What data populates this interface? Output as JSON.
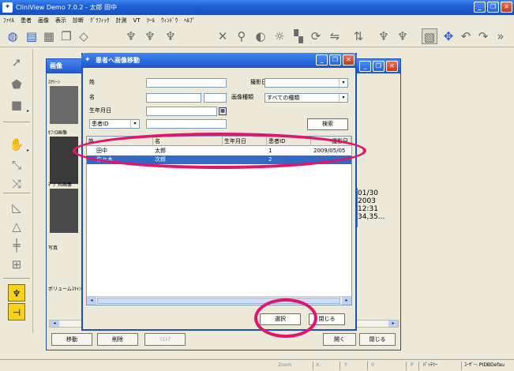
{
  "app": {
    "title": "CliniView Demo 7.0.2 - 太郎 田中",
    "menu": [
      "ﾌｧｲﾙ",
      "患者",
      "画像",
      "表示",
      "診断",
      "ｸﾞﾗﾌｨｯｸ",
      "計測",
      "VT",
      "ﾂｰﾙ",
      "ｳｨﾝﾄﾞｳ",
      "ﾍﾙﾌﾟ"
    ]
  },
  "patient_window": {
    "title": "画像",
    "thumb_labels": [
      "ｽｸﾘｰﾝ",
      "ｾﾌｧﾛ画像",
      "ﾃﾞｼﾞﾀﾙ画像",
      "写真",
      "ボリュームｽｷｬﾝ"
    ],
    "info": "01/30\n2003\n12:31\n34,35...",
    "buttons": {
      "move": "移動",
      "delete": "削除",
      "listing": "ﾘｽﾄｱ",
      "open": "開く",
      "close": "閉じる"
    }
  },
  "dialog": {
    "title": "患者へ画像移動",
    "labels": {
      "last_name": "姓",
      "first_name": "名",
      "birthdate": "生年月日",
      "capture_date": "撮影日",
      "image_type": "画像種類"
    },
    "image_type_value": "すべての種類",
    "id_type_value": "患者ID",
    "search_button": "検索",
    "columns": [
      "姓",
      "名",
      "生年月日",
      "患者ID",
      "撮影日"
    ],
    "rows": [
      {
        "last": "田中",
        "first": "太郎",
        "birth": "",
        "id": "1",
        "date": "2009/05/05"
      },
      {
        "last": "佐々木",
        "first": "次郎",
        "birth": "",
        "id": "2",
        "date": ""
      }
    ],
    "select_button": "選択",
    "close_button": "閉じる"
  },
  "statusbar": {
    "zoom": "Zoom",
    "x": "X:",
    "y": "Y:",
    "o": "0",
    "p": "P",
    "battery": "ﾊﾞｯﾃﾘｰ",
    "user": "ﾕｰｻﾞｰ: PIDBDefau"
  },
  "colors": {
    "titlebar": "#1f5fd6",
    "selection": "#316ac5",
    "annotation": "#e0156e"
  }
}
